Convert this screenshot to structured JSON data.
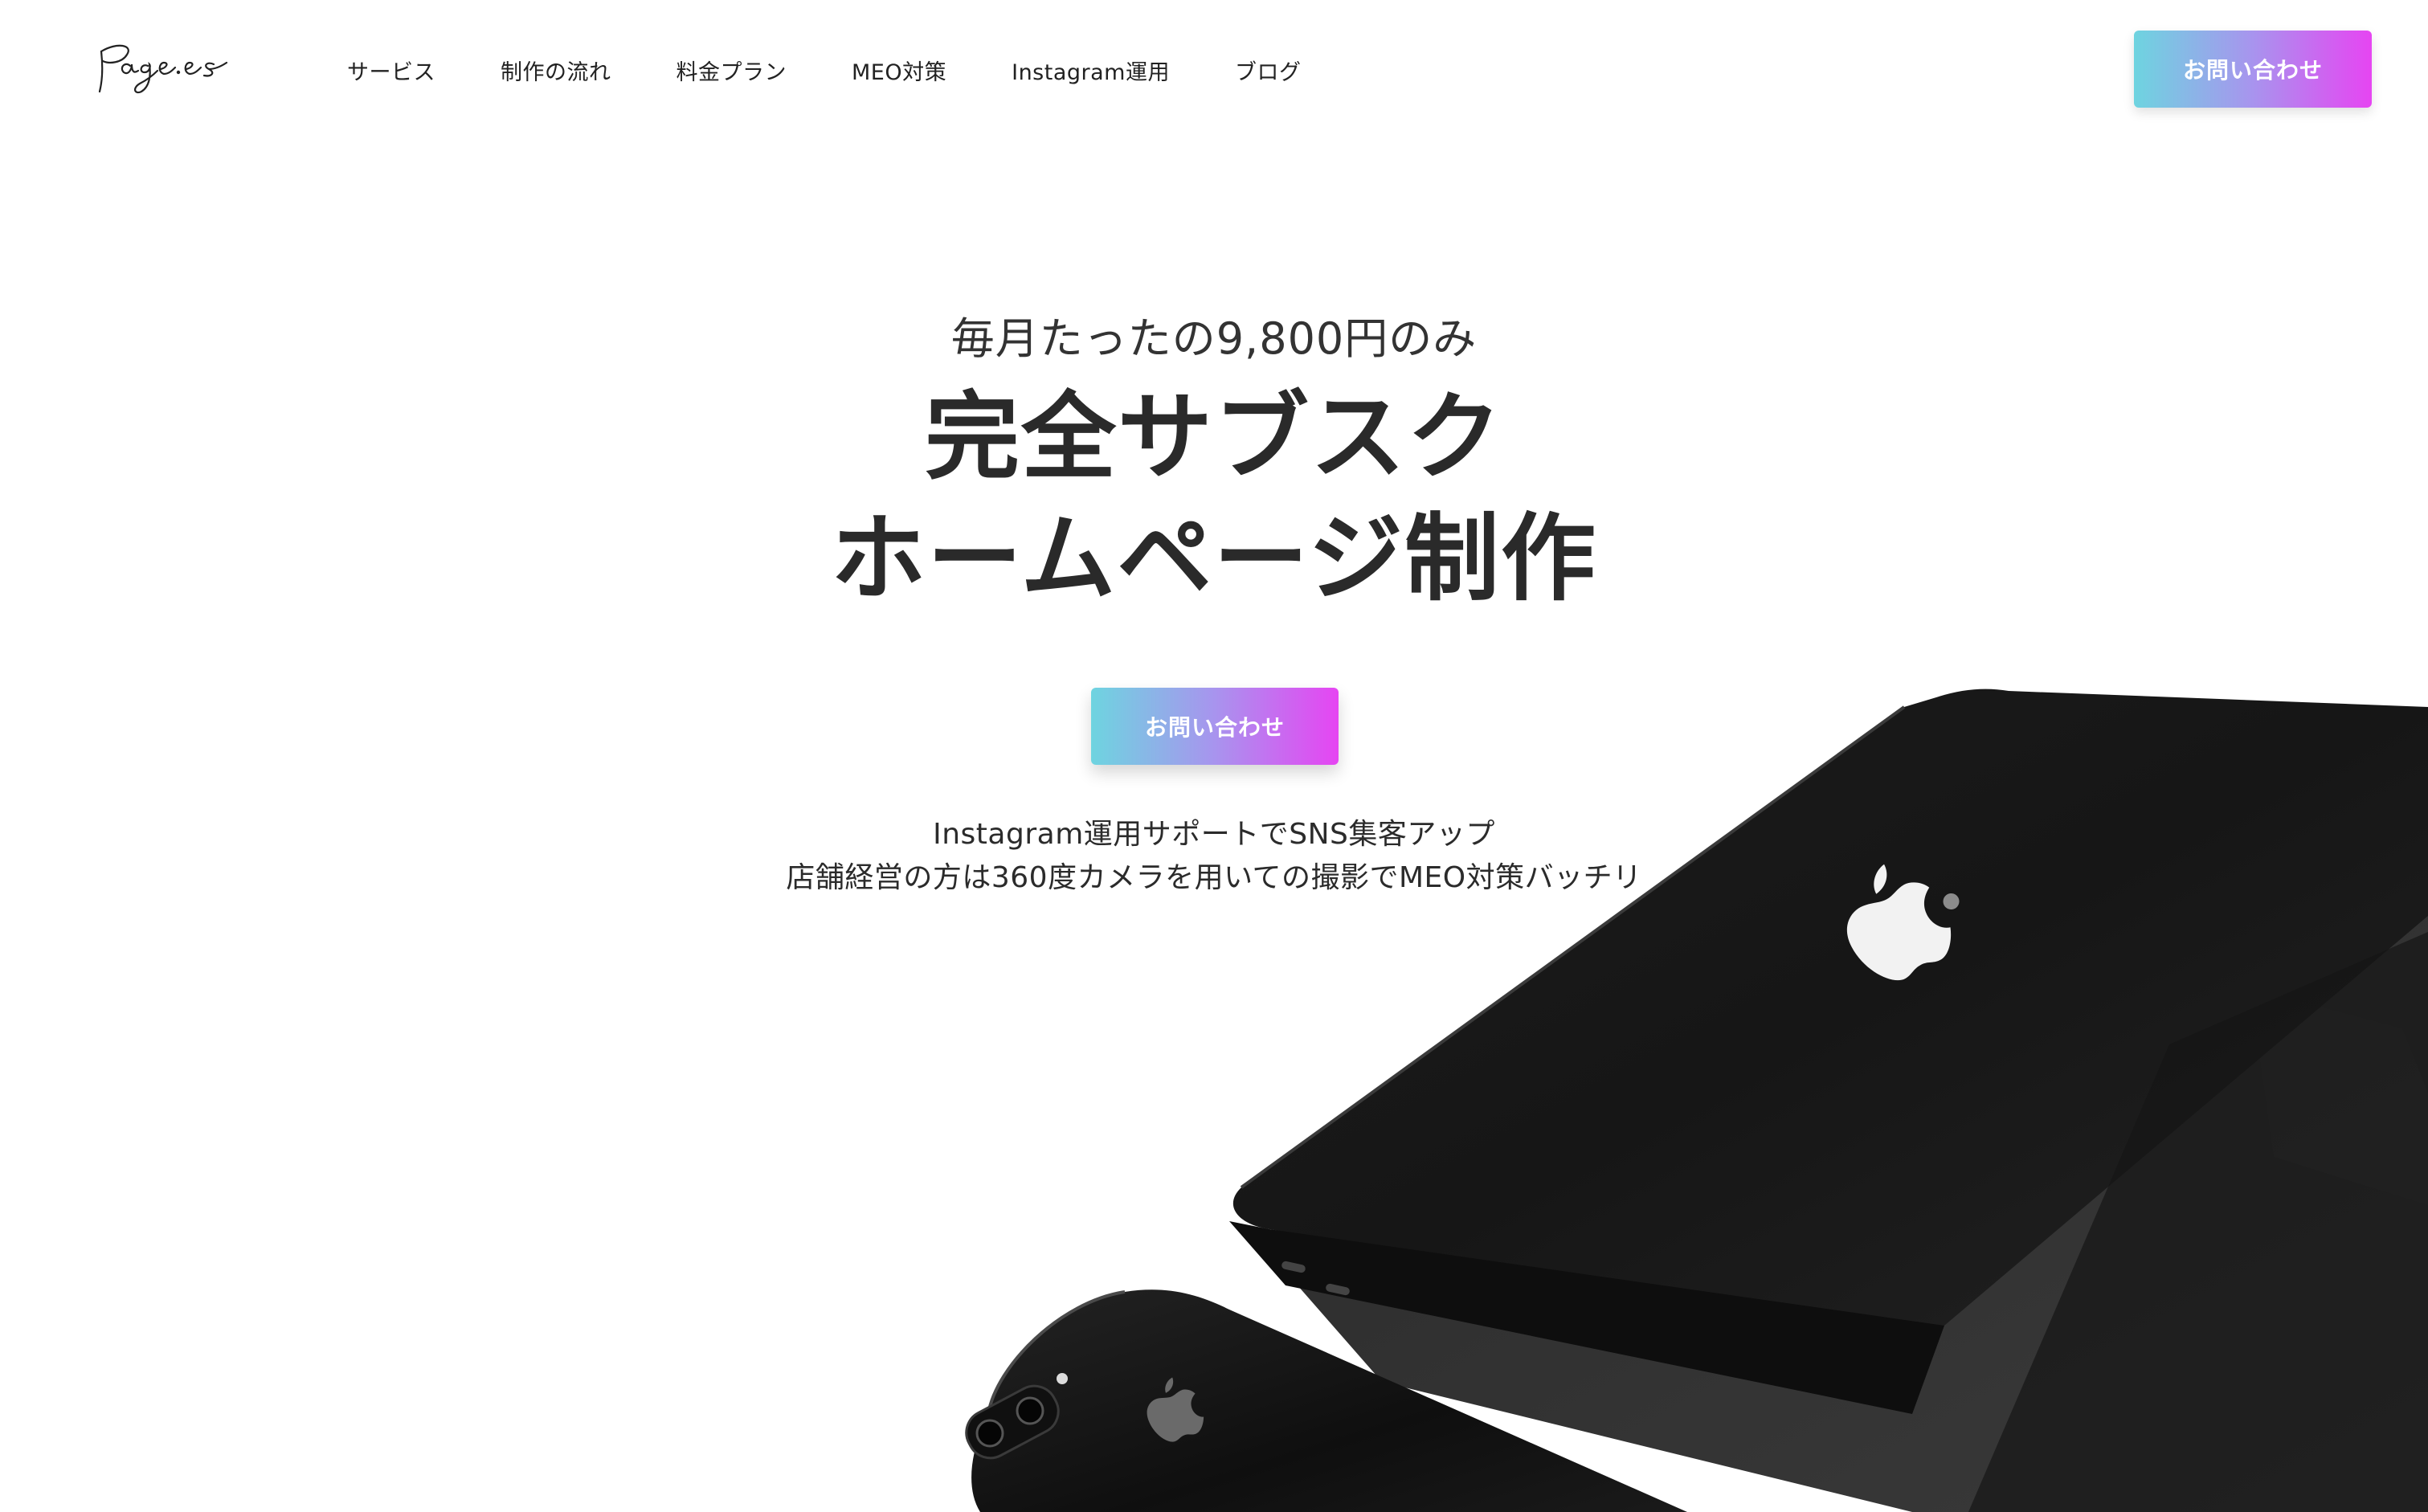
{
  "header": {
    "logo_icon": "page-es-script-logo",
    "nav_items": [
      {
        "label": "サービス"
      },
      {
        "label": "制作の流れ"
      },
      {
        "label": "料金プラン"
      },
      {
        "label": "MEO対策"
      },
      {
        "label": "Instagram運用"
      },
      {
        "label": "ブログ"
      }
    ],
    "contact_label": "お問い合わせ"
  },
  "hero": {
    "subtitle": "毎月たったの9,800円のみ",
    "title_line1": "完全サブスク",
    "title_line2": "ホームページ制作",
    "contact_label": "お問い合わせ",
    "desc_line1": "Instagram運用サポートでSNS集客アップ",
    "desc_line2": "店舗経営の方は360度カメラを用いての撮影でMEO対策バッチリ"
  },
  "illustration": {
    "laptop_icon": "laptop-icon",
    "phone_icon": "phone-icon",
    "apple_logo_icon": "apple-logo-icon"
  },
  "colors": {
    "gradient_start": "#6ed4e0",
    "gradient_mid": "#a894ee",
    "gradient_end": "#e645f2",
    "text": "#2a2a2a",
    "background": "#ffffff"
  }
}
